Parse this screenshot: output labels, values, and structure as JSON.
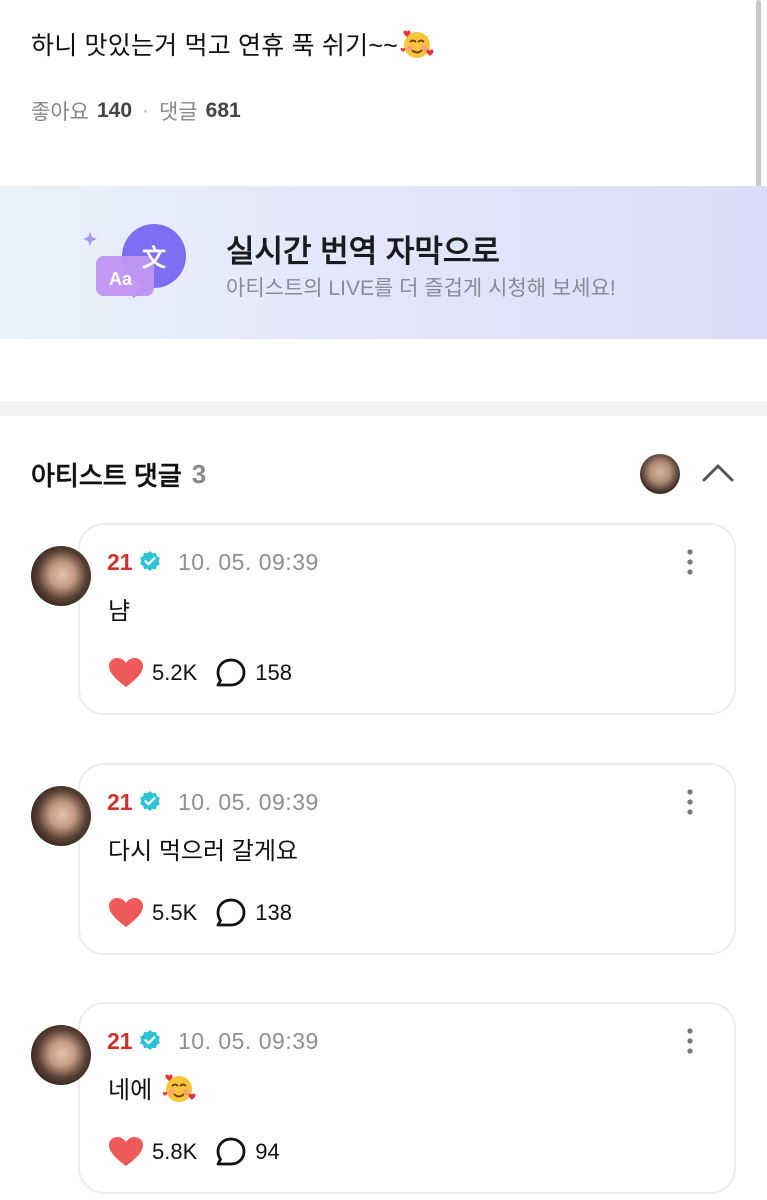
{
  "post": {
    "text": "하니 맛있는거 먹고 연휴 푹 쉬기~~",
    "emoji": "smiling-face-with-hearts",
    "likes_label": "좋아요",
    "likes_count": "140",
    "separator": "·",
    "comments_label": "댓글",
    "comments_count": "681"
  },
  "banner": {
    "title": "실시간 번역 자막으로",
    "subtitle": "아티스트의 LIVE를 더 즐겁게 시청해 보세요!",
    "icon": "translate-icon",
    "icon_glyph": "文",
    "icon_text": "Aa"
  },
  "artist_comments": {
    "title": "아티스트 댓글",
    "count": "3",
    "collapse_icon": "chevron-up-icon"
  },
  "comments": [
    {
      "author": "21",
      "time": "10. 05. 09:39",
      "text": "냠",
      "has_emoji": false,
      "likes": "5.2K",
      "replies": "158"
    },
    {
      "author": "21",
      "time": "10. 05. 09:39",
      "text": "다시 먹으러 갈게요",
      "has_emoji": false,
      "likes": "5.5K",
      "replies": "138"
    },
    {
      "author": "21",
      "time": "10. 05. 09:39",
      "text": "네에",
      "has_emoji": true,
      "likes": "5.8K",
      "replies": "94"
    }
  ],
  "colors": {
    "author_name": "#d0312d",
    "verified": "#2cc3d6",
    "heart": "#ee5a5a",
    "banner_accent": "#8f7cf0"
  }
}
